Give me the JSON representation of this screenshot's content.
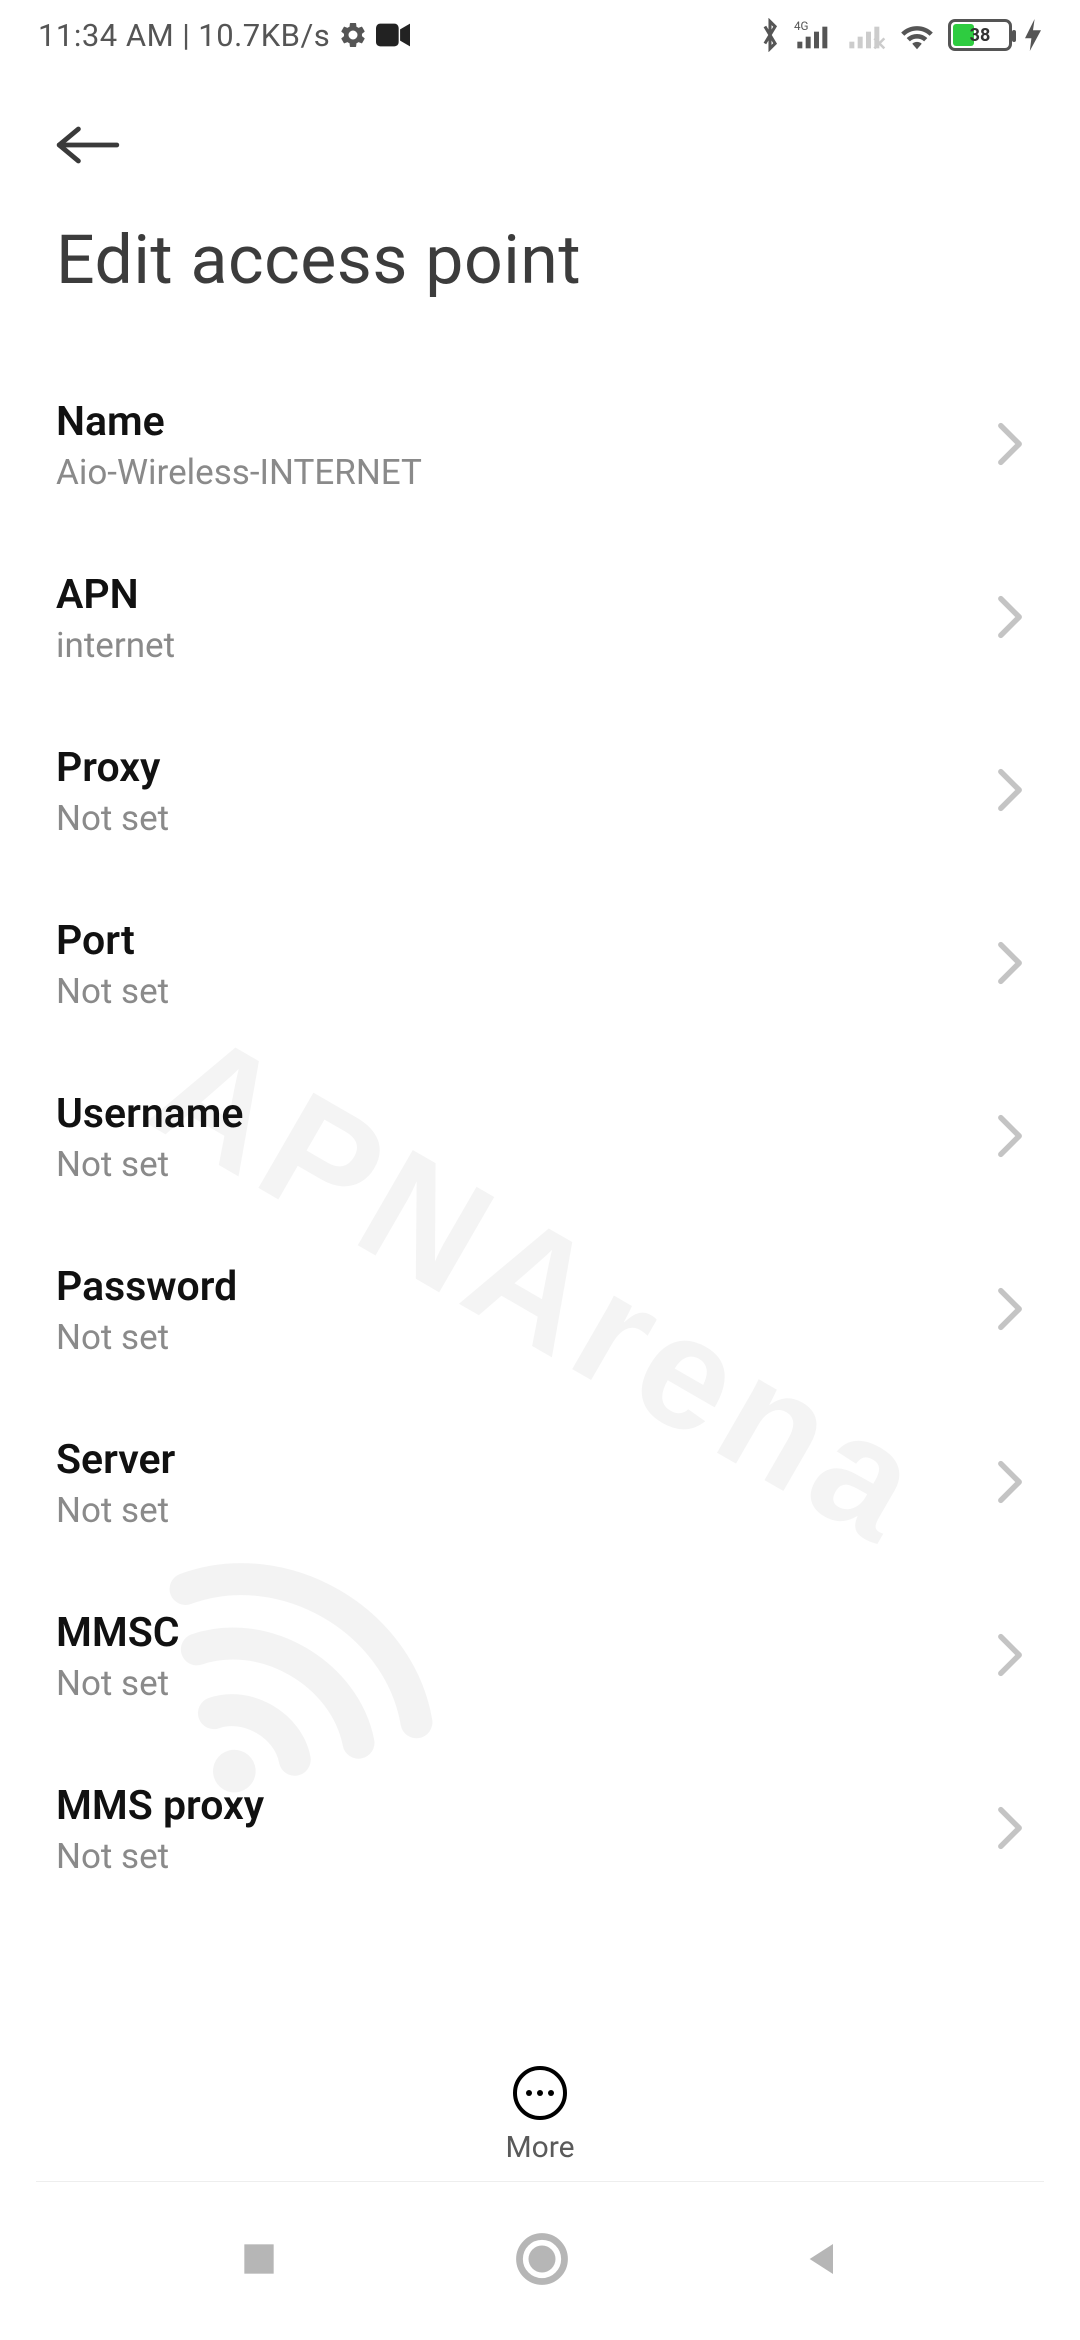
{
  "status": {
    "time": "11:34 AM",
    "separator": "|",
    "net_speed": "10.7KB/s",
    "battery_percent": "38"
  },
  "page": {
    "title": "Edit access point"
  },
  "fields": [
    {
      "label": "Name",
      "value": "Aio-Wireless-INTERNET"
    },
    {
      "label": "APN",
      "value": "internet"
    },
    {
      "label": "Proxy",
      "value": "Not set"
    },
    {
      "label": "Port",
      "value": "Not set"
    },
    {
      "label": "Username",
      "value": "Not set"
    },
    {
      "label": "Password",
      "value": "Not set"
    },
    {
      "label": "Server",
      "value": "Not set"
    },
    {
      "label": "MMSC",
      "value": "Not set"
    },
    {
      "label": "MMS proxy",
      "value": "Not set"
    }
  ],
  "bottom": {
    "more_label": "More"
  },
  "watermark": "APNArena"
}
